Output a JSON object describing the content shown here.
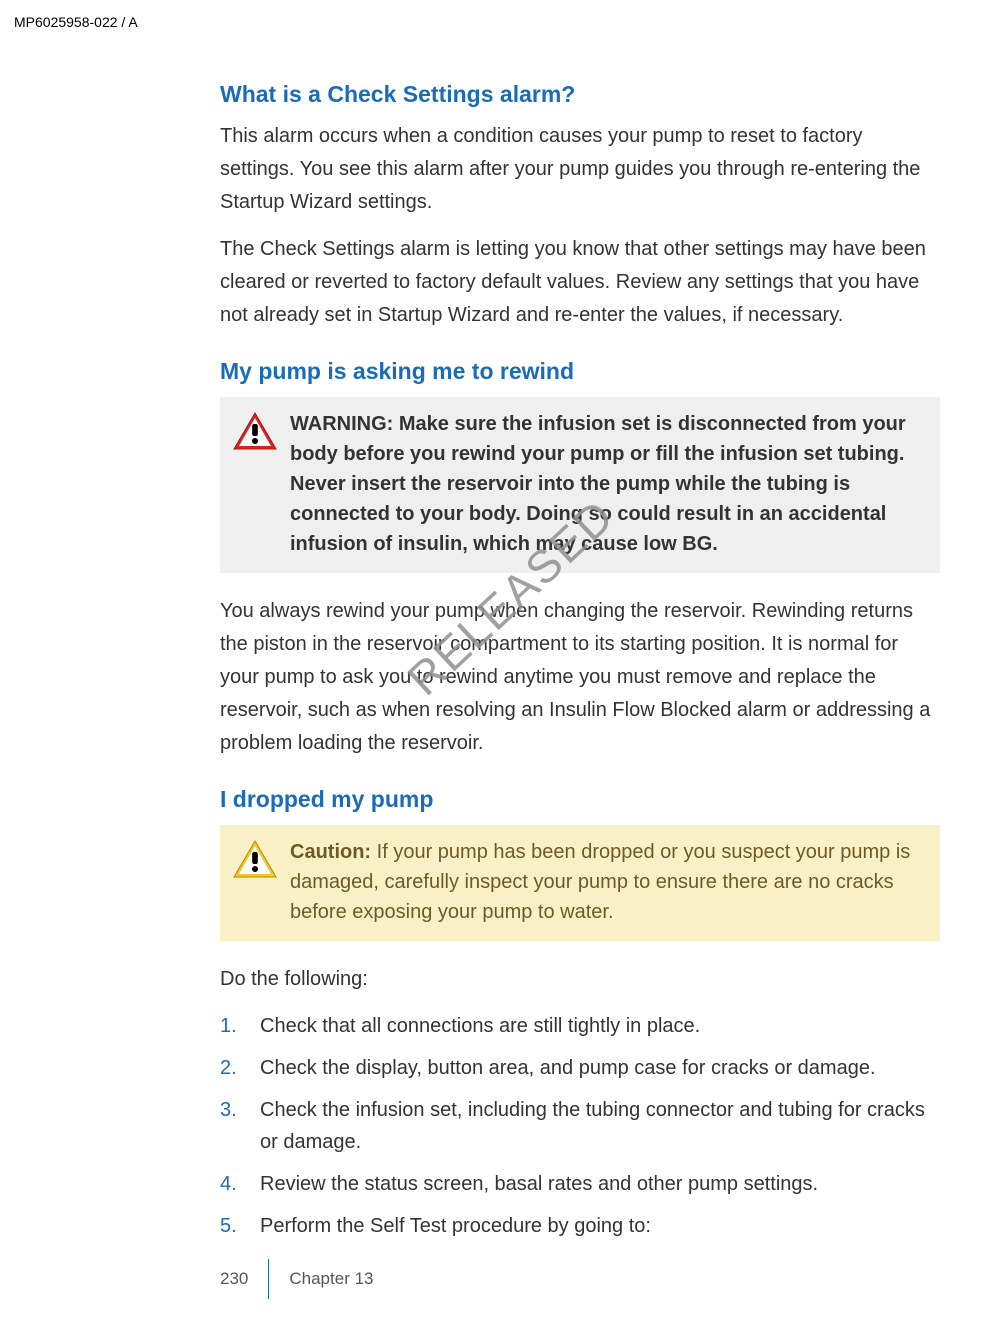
{
  "header": {
    "doc_id": "MP6025958-022 / A"
  },
  "sections": {
    "s1": {
      "title": "What is a Check Settings alarm?",
      "p1": "This alarm occurs when a condition causes your pump to reset to factory settings. You see this alarm after your pump guides you through re-entering the Startup Wizard settings.",
      "p2": "The Check Settings alarm is letting you know that other settings may have been cleared or reverted to factory default values. Review any settings that you have not already set in Startup Wizard and re-enter the values, if necessary."
    },
    "s2": {
      "title": "My pump is asking me to rewind",
      "warning_label": "WARNING:  ",
      "warning_text": "Make sure the infusion set is disconnected from your body before you rewind your pump or fill the infusion set tubing. Never insert the reservoir into the pump while the tubing is connected to your body. Doing so could result in an accidental infusion of insulin, which may cause low BG.",
      "p1": "You always rewind your pump when changing the reservoir. Rewinding returns the piston in the reservoir compartment to its starting position. It is normal for your pump to ask you to rewind anytime you must remove and replace the reservoir, such as when resolving an Insulin Flow Blocked alarm or addressing a problem loading the reservoir."
    },
    "s3": {
      "title": "I dropped my pump",
      "caution_label": "Caution:  ",
      "caution_text": "If your pump has been dropped or you suspect your pump is damaged, carefully inspect your pump to ensure there are no cracks before exposing your pump to water.",
      "lead": "Do the following:",
      "steps": [
        "Check that all connections are still tightly in place.",
        "Check the display, button area, and pump case for cracks or damage.",
        "Check the infusion set, including the tubing connector and tubing for cracks or damage.",
        "Review the status screen, basal rates and other pump settings.",
        "Perform the Self Test procedure by going to:"
      ]
    }
  },
  "watermark": "RELEASED",
  "footer": {
    "page": "230",
    "chapter": "Chapter 13"
  }
}
